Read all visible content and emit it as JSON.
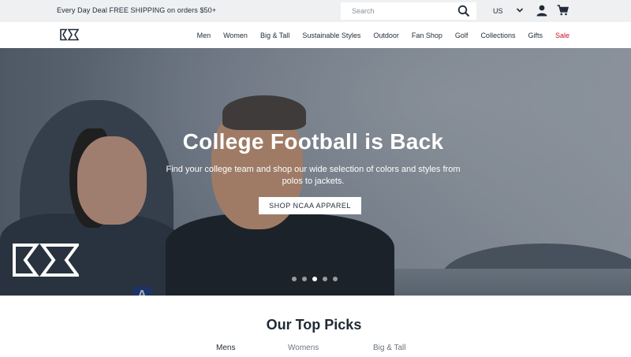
{
  "topbar": {
    "promo": "Every Day Deal FREE SHIPPING on orders $50+",
    "search_placeholder": "Search",
    "locale": "US"
  },
  "nav": {
    "items": [
      "Men",
      "Women",
      "Big & Tall",
      "Sustainable Styles",
      "Outdoor",
      "Fan Shop",
      "Golf",
      "Collections",
      "Gifts",
      "Sale"
    ]
  },
  "hero": {
    "title": "College Football is Back",
    "subtitle": "Find your college team and shop our wide selection of colors and styles from polos to jackets.",
    "cta": "SHOP NCAA APPAREL",
    "slides": 5,
    "active_slide": 3
  },
  "picks": {
    "title": "Our Top Picks",
    "tabs": [
      "Mens",
      "Womens",
      "Big & Tall"
    ],
    "active_tab": 0
  },
  "colors": {
    "topbar_bg": "#eef0f2",
    "text": "#1f2a36",
    "sale": "#c8102e"
  }
}
